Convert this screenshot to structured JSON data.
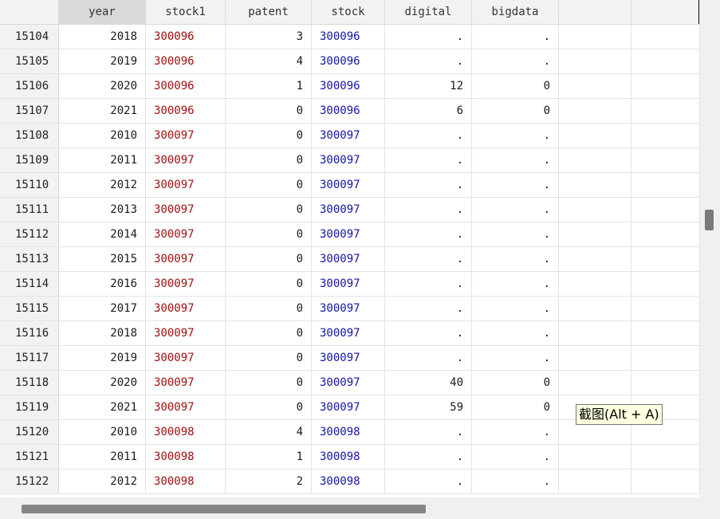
{
  "columns": [
    "year",
    "stock1",
    "patent",
    "stock",
    "digital",
    "bigdata"
  ],
  "rows": [
    [
      "15104",
      "2018",
      "300096",
      "3",
      "300096",
      ".",
      "."
    ],
    [
      "15105",
      "2019",
      "300096",
      "4",
      "300096",
      ".",
      "."
    ],
    [
      "15106",
      "2020",
      "300096",
      "1",
      "300096",
      "12",
      "0"
    ],
    [
      "15107",
      "2021",
      "300096",
      "0",
      "300096",
      "6",
      "0"
    ],
    [
      "15108",
      "2010",
      "300097",
      "0",
      "300097",
      ".",
      "."
    ],
    [
      "15109",
      "2011",
      "300097",
      "0",
      "300097",
      ".",
      "."
    ],
    [
      "15110",
      "2012",
      "300097",
      "0",
      "300097",
      ".",
      "."
    ],
    [
      "15111",
      "2013",
      "300097",
      "0",
      "300097",
      ".",
      "."
    ],
    [
      "15112",
      "2014",
      "300097",
      "0",
      "300097",
      ".",
      "."
    ],
    [
      "15113",
      "2015",
      "300097",
      "0",
      "300097",
      ".",
      "."
    ],
    [
      "15114",
      "2016",
      "300097",
      "0",
      "300097",
      ".",
      "."
    ],
    [
      "15115",
      "2017",
      "300097",
      "0",
      "300097",
      ".",
      "."
    ],
    [
      "15116",
      "2018",
      "300097",
      "0",
      "300097",
      ".",
      "."
    ],
    [
      "15117",
      "2019",
      "300097",
      "0",
      "300097",
      ".",
      "."
    ],
    [
      "15118",
      "2020",
      "300097",
      "0",
      "300097",
      "40",
      "0"
    ],
    [
      "15119",
      "2021",
      "300097",
      "0",
      "300097",
      "59",
      "0"
    ],
    [
      "15120",
      "2010",
      "300098",
      "4",
      "300098",
      ".",
      "."
    ],
    [
      "15121",
      "2011",
      "300098",
      "1",
      "300098",
      ".",
      "."
    ],
    [
      "15122",
      "2012",
      "300098",
      "2",
      "300098",
      ".",
      "."
    ]
  ],
  "tooltip": "截图(Alt + A)",
  "colors": {
    "stock1_text": "#a01010",
    "stock_text": "#1515a8",
    "selected_header": "#d9d9d9"
  }
}
